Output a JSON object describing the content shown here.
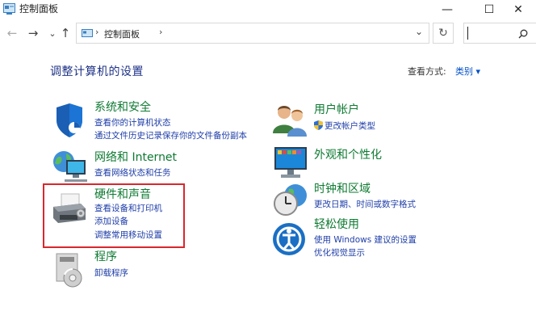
{
  "window": {
    "title": "控制面板",
    "minimize": "—",
    "maximize": "☐",
    "close": "✕"
  },
  "nav": {
    "back": "←",
    "forward": "→",
    "recent": "⌄",
    "up": "↑"
  },
  "address": {
    "path": "控制面板",
    "separator": "›",
    "dropdown": "⌄",
    "refresh": "↻"
  },
  "search": {
    "placeholder": "",
    "icon": "search-icon"
  },
  "page_title": "调整计算机的设置",
  "view_by": {
    "label": "查看方式:",
    "value": "类别 ▾"
  },
  "categories_left": [
    {
      "title": "系统和安全",
      "icon": "shield-icon",
      "links": [
        "查看你的计算机状态",
        "通过文件历史记录保存你的文件备份副本"
      ]
    },
    {
      "title": "网络和 Internet",
      "icon": "network-globe-icon",
      "links": [
        "查看网络状态和任务"
      ]
    },
    {
      "title": "硬件和声音",
      "icon": "printer-icon",
      "links": [
        "查看设备和打印机",
        "添加设备",
        "调整常用移动设置"
      ]
    },
    {
      "title": "程序",
      "icon": "programs-icon",
      "links": [
        "卸载程序"
      ]
    }
  ],
  "categories_right": [
    {
      "title": "用户帐户",
      "icon": "users-icon",
      "links": [
        "更改帐户类型"
      ]
    },
    {
      "title": "外观和个性化",
      "icon": "monitor-icon",
      "links": []
    },
    {
      "title": "时钟和区域",
      "icon": "clock-globe-icon",
      "links": [
        "更改日期、时间或数字格式"
      ]
    },
    {
      "title": "轻松使用",
      "icon": "ease-of-access-icon",
      "links": [
        "使用 Windows 建议的设置",
        "优化视觉显示"
      ]
    }
  ],
  "colors": {
    "category_title": "#0e7a32",
    "link": "#1f3ea8",
    "highlight": "#d9272d",
    "page_title": "#1e3287"
  }
}
